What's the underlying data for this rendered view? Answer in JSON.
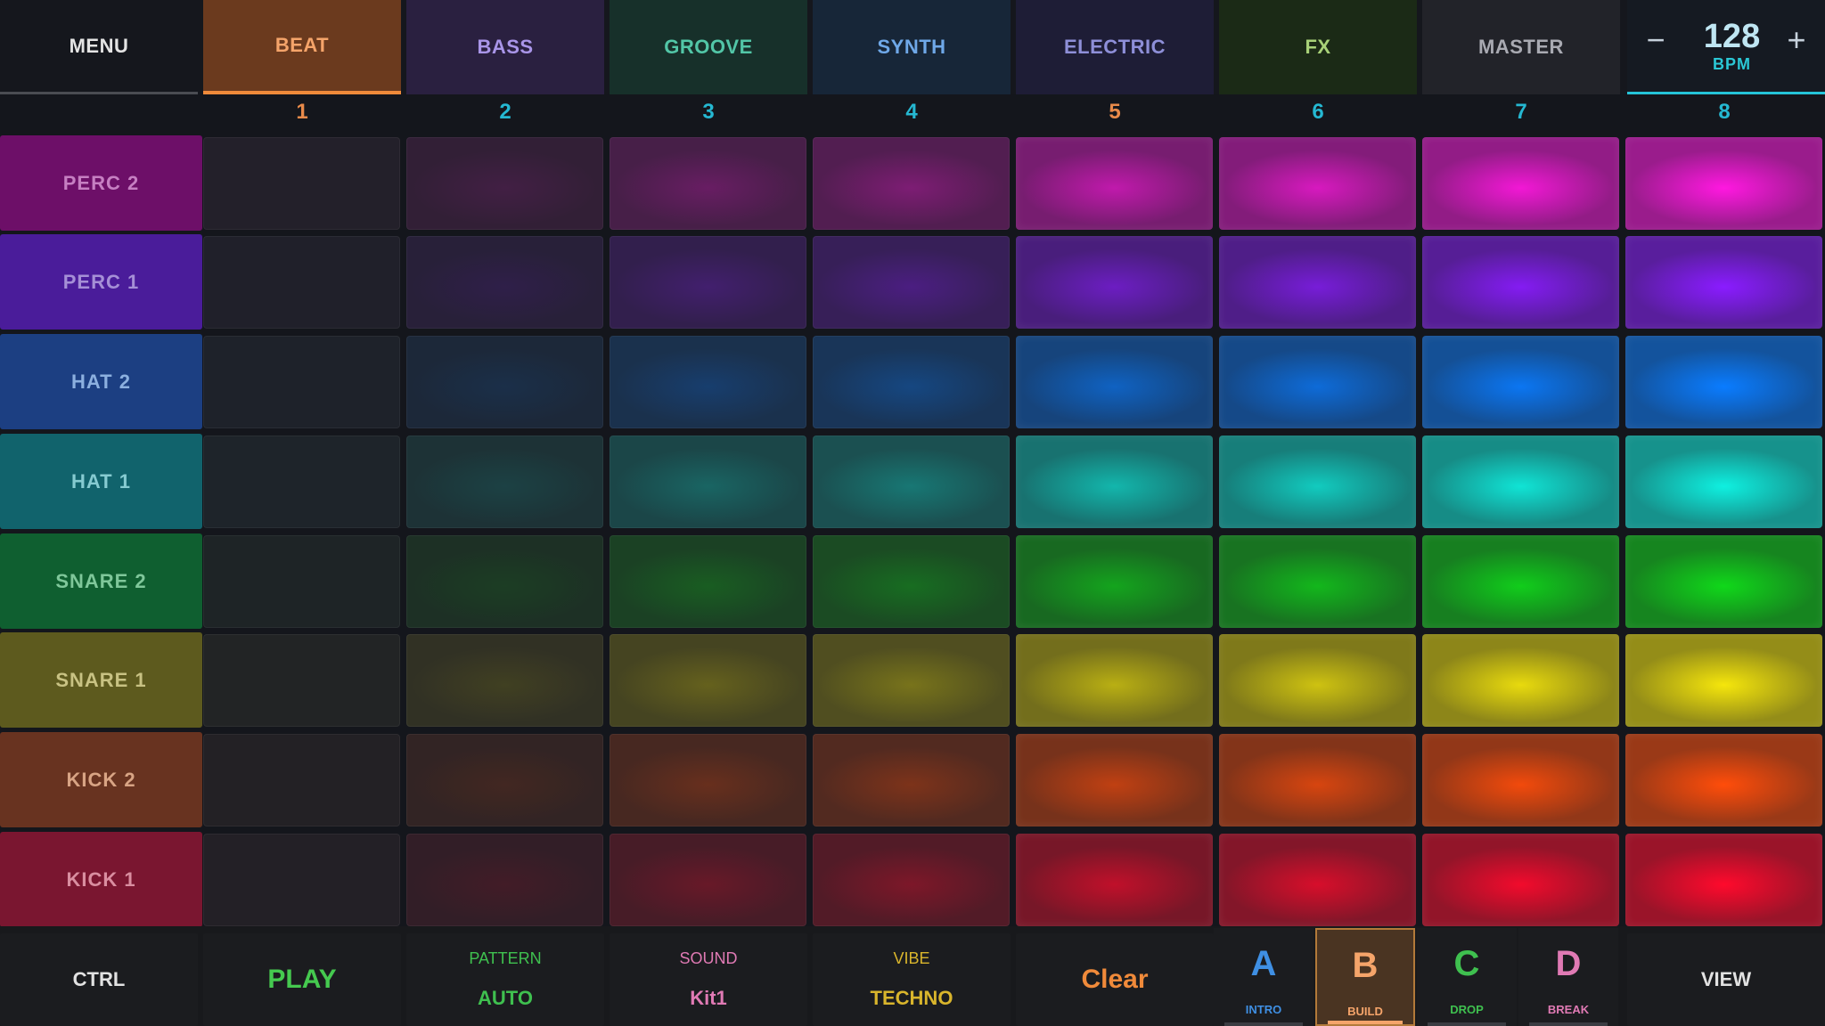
{
  "header": {
    "menu_label": "MENU",
    "tabs": [
      {
        "label": "BEAT",
        "color": "#f5a46a",
        "bg": "#6b3a1e",
        "active": true
      },
      {
        "label": "BASS",
        "color": "#a995e8",
        "bg": "#2a2040",
        "active": false
      },
      {
        "label": "GROOVE",
        "color": "#52c6a7",
        "bg": "#17302a",
        "active": false
      },
      {
        "label": "SYNTH",
        "color": "#6fa8e8",
        "bg": "#172638",
        "active": false
      },
      {
        "label": "ELECTRIC",
        "color": "#8e8fd8",
        "bg": "#1e1d36",
        "active": false
      },
      {
        "label": "FX",
        "color": "#a8d178",
        "bg": "#1b2a16",
        "active": false
      },
      {
        "label": "MASTER",
        "color": "#a9aab2",
        "bg": "#222329",
        "active": false
      }
    ],
    "bpm": {
      "minus": "−",
      "value": "128",
      "unit": "BPM",
      "plus": "+"
    }
  },
  "columns": [
    {
      "label": "1",
      "color": "#e88a4a"
    },
    {
      "label": "2",
      "color": "#25b8d2"
    },
    {
      "label": "3",
      "color": "#25b8d2"
    },
    {
      "label": "4",
      "color": "#25b8d2"
    },
    {
      "label": "5",
      "color": "#e88a4a"
    },
    {
      "label": "6",
      "color": "#25b8d2"
    },
    {
      "label": "7",
      "color": "#25b8d2"
    },
    {
      "label": "8",
      "color": "#25b8d2"
    }
  ],
  "tracks": [
    {
      "label": "PERC 2",
      "color": "#ff18e0",
      "labelBg": "#6d0f68",
      "labelColor": "#c67fc2"
    },
    {
      "label": "PERC 1",
      "color": "#8a1cff",
      "labelBg": "#4a1c9a",
      "labelColor": "#a58fd6"
    },
    {
      "label": "HAT 2",
      "color": "#0a7cff",
      "labelBg": "#1c3f82",
      "labelColor": "#8cb0df"
    },
    {
      "label": "HAT 1",
      "color": "#0ff0e0",
      "labelBg": "#11636c",
      "labelColor": "#86cbd1"
    },
    {
      "label": "SNARE 2",
      "color": "#10d81a",
      "labelBg": "#0f5f30",
      "labelColor": "#7fc79a"
    },
    {
      "label": "SNARE 1",
      "color": "#f5e60c",
      "labelBg": "#5d5a1e",
      "labelColor": "#c8c283"
    },
    {
      "label": "KICK 2",
      "color": "#ff4d0a",
      "labelBg": "#683320",
      "labelColor": "#d8a484"
    },
    {
      "label": "KICK 1",
      "color": "#ff0a2c",
      "labelBg": "#7a1630",
      "labelColor": "#d98ea0"
    }
  ],
  "pad_intensity": [
    0,
    0.16,
    0.33,
    0.42,
    0.72,
    0.82,
    0.94,
    1.0
  ],
  "bottom": {
    "ctrl_label": "CTRL",
    "play_label": "PLAY",
    "pattern": {
      "label": "PATTERN",
      "value": "AUTO"
    },
    "sound": {
      "label": "SOUND",
      "value": "Kit1"
    },
    "vibe": {
      "label": "VIBE",
      "value": "TECHNO"
    },
    "clear_label": "Clear",
    "scenes": [
      {
        "letter": "A",
        "label": "INTRO",
        "color": "#3f8fe3",
        "active": false
      },
      {
        "letter": "B",
        "label": "BUILD",
        "color": "#f5a46a",
        "active": true
      },
      {
        "letter": "C",
        "label": "DROP",
        "color": "#3fc04f",
        "active": false
      },
      {
        "letter": "D",
        "label": "BREAK",
        "color": "#e07ab4",
        "active": false
      }
    ],
    "view_label": "VIEW"
  }
}
